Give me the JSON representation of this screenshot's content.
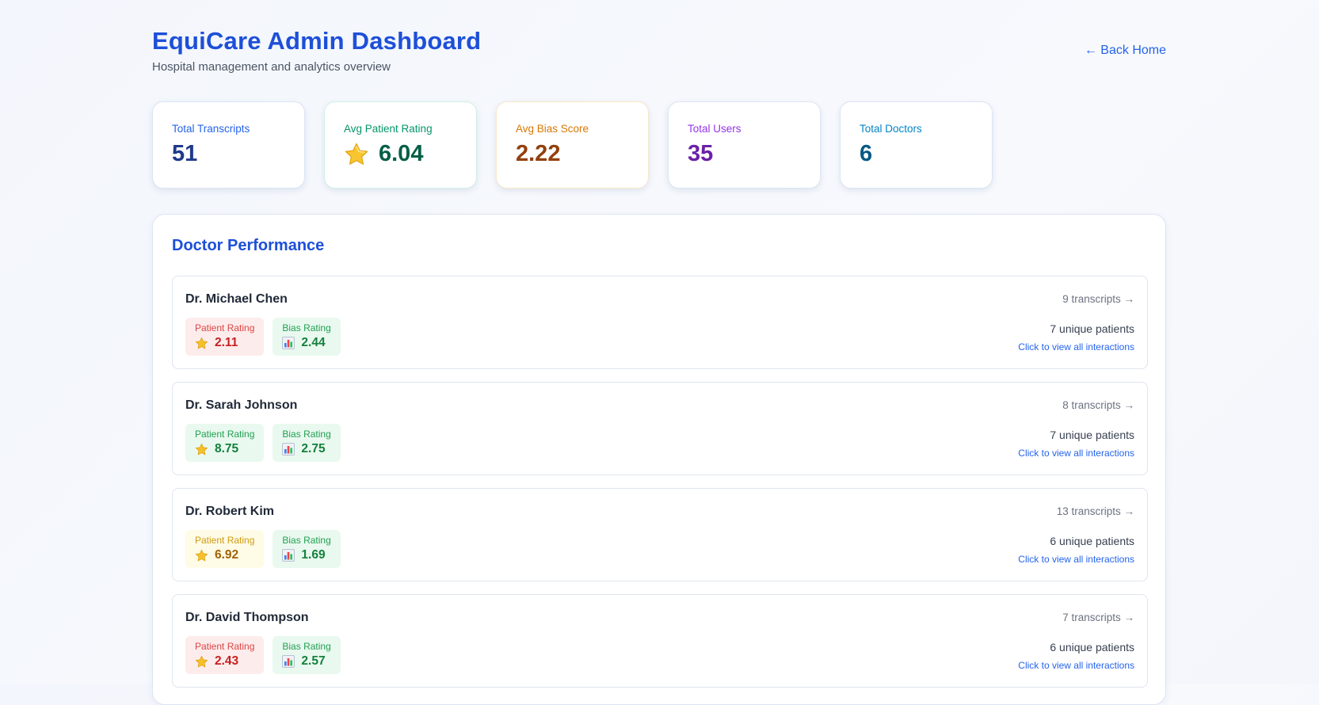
{
  "header": {
    "title": "EquiCare Admin Dashboard",
    "subtitle": "Hospital management and analytics overview",
    "back_link": "← Back Home"
  },
  "stats": [
    {
      "label": "Total Transcripts",
      "value": "51",
      "color": "#1e3a8a"
    },
    {
      "label": "Avg Patient Rating",
      "value": "6.04",
      "icon": "star-icon",
      "color": "#065f46"
    },
    {
      "label": "Avg Bias Score",
      "value": "2.22",
      "color": "#92400e"
    },
    {
      "label": "Total Users",
      "value": "35",
      "color": "#6b21a8"
    },
    {
      "label": "Total Doctors",
      "value": "6",
      "color": "#075985"
    }
  ],
  "panel": {
    "title": "Doctor Performance"
  },
  "badge_labels": {
    "patient_rating": "Patient Rating",
    "bias_rating": "Bias Rating"
  },
  "doctors": [
    {
      "name": "Dr. Michael Chen",
      "patient_rating": "2.11",
      "patient_rating_tone": "red",
      "bias_rating": "2.44",
      "bias_rating_tone": "green",
      "transcripts": "9 transcripts →",
      "patients": "7 unique patients",
      "link": "Click to view all interactions"
    },
    {
      "name": "Dr. Sarah Johnson",
      "patient_rating": "8.75",
      "patient_rating_tone": "green",
      "bias_rating": "2.75",
      "bias_rating_tone": "green",
      "transcripts": "8 transcripts →",
      "patients": "7 unique patients",
      "link": "Click to view all interactions"
    },
    {
      "name": "Dr. Robert Kim",
      "patient_rating": "6.92",
      "patient_rating_tone": "yellow",
      "bias_rating": "1.69",
      "bias_rating_tone": "green",
      "transcripts": "13 transcripts →",
      "patients": "6 unique patients",
      "link": "Click to view all interactions"
    },
    {
      "name": "Dr. David Thompson",
      "patient_rating": "2.43",
      "patient_rating_tone": "red",
      "bias_rating": "2.57",
      "bias_rating_tone": "green",
      "transcripts": "7 transcripts →",
      "patients": "6 unique patients",
      "link": "Click to view all interactions"
    }
  ],
  "colors": {
    "accent": "#1d4fd8",
    "rating_red": "#c52121",
    "rating_green": "#15803d",
    "rating_yellow": "#a16207"
  }
}
